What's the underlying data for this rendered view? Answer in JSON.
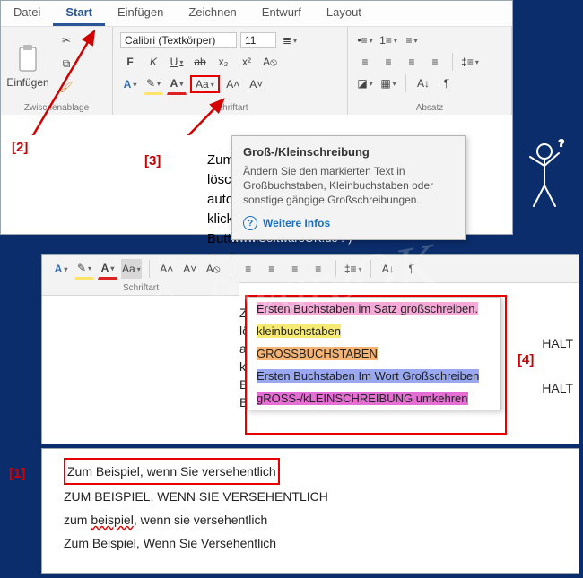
{
  "watermark": "SoftwareOK",
  "site_line": "www.SoftwareOK.de  :-)",
  "tabs": [
    "Datei",
    "Start",
    "Einfügen",
    "Zeichnen",
    "Entwurf",
    "Layout"
  ],
  "ribbon": {
    "clipboard": {
      "title": "Zwischenablage",
      "paste_label": "Einfügen"
    },
    "font": {
      "title": "Schriftart",
      "name": "Calibri (Textkörper)",
      "size": "11",
      "bold": "F",
      "italic": "K",
      "underline": "U",
      "strike": "ab",
      "sub": "x₂",
      "sup": "x²",
      "case_btn": "Aa",
      "grow": "A˄",
      "shrink": "A˅",
      "clear": "A⦸",
      "outline": "A",
      "highlight": "✎",
      "color": "A"
    },
    "para": {
      "title": "Absatz"
    }
  },
  "tooltip": {
    "title": "Groß-/Kleinschreibung",
    "body": "Ändern Sie den markierten Text in Großbuchstaben, Kleinbuchstaben oder sonstige gängige Großschreibungen.",
    "link": "Weitere Infos"
  },
  "doc_lines": [
    "Zum I",
    "lösch",
    "autoi",
    "klicke",
    "Butto",
    "Backu"
  ],
  "labels": {
    "l1": "[1]",
    "l2": "[2]",
    "l3": "[3]",
    "l4": "[4]"
  },
  "menu": [
    "Ersten Buchstaben im Satz großschreiben.",
    "kleinbuchstaben",
    "GROSSBUCHSTABEN",
    "Ersten Buchstaben Im Wort Großschreiben",
    "gROSS-/kLEINSCHREIBUNG umkehren"
  ],
  "p2_doc": [
    "Zum I",
    "lösch",
    "autoi",
    "klicke",
    "Butto",
    "Backu"
  ],
  "p2_right": [
    "HALT",
    "HALT"
  ],
  "samples": [
    "Zum Beispiel, wenn Sie versehentlich",
    "ZUM BEISPIEL, WENN SIE VERSEHENTLICH",
    "zum beispiel, wenn sie versehentlich",
    "Zum Beispiel, Wenn Sie Versehentlich"
  ],
  "right_clip": "S"
}
